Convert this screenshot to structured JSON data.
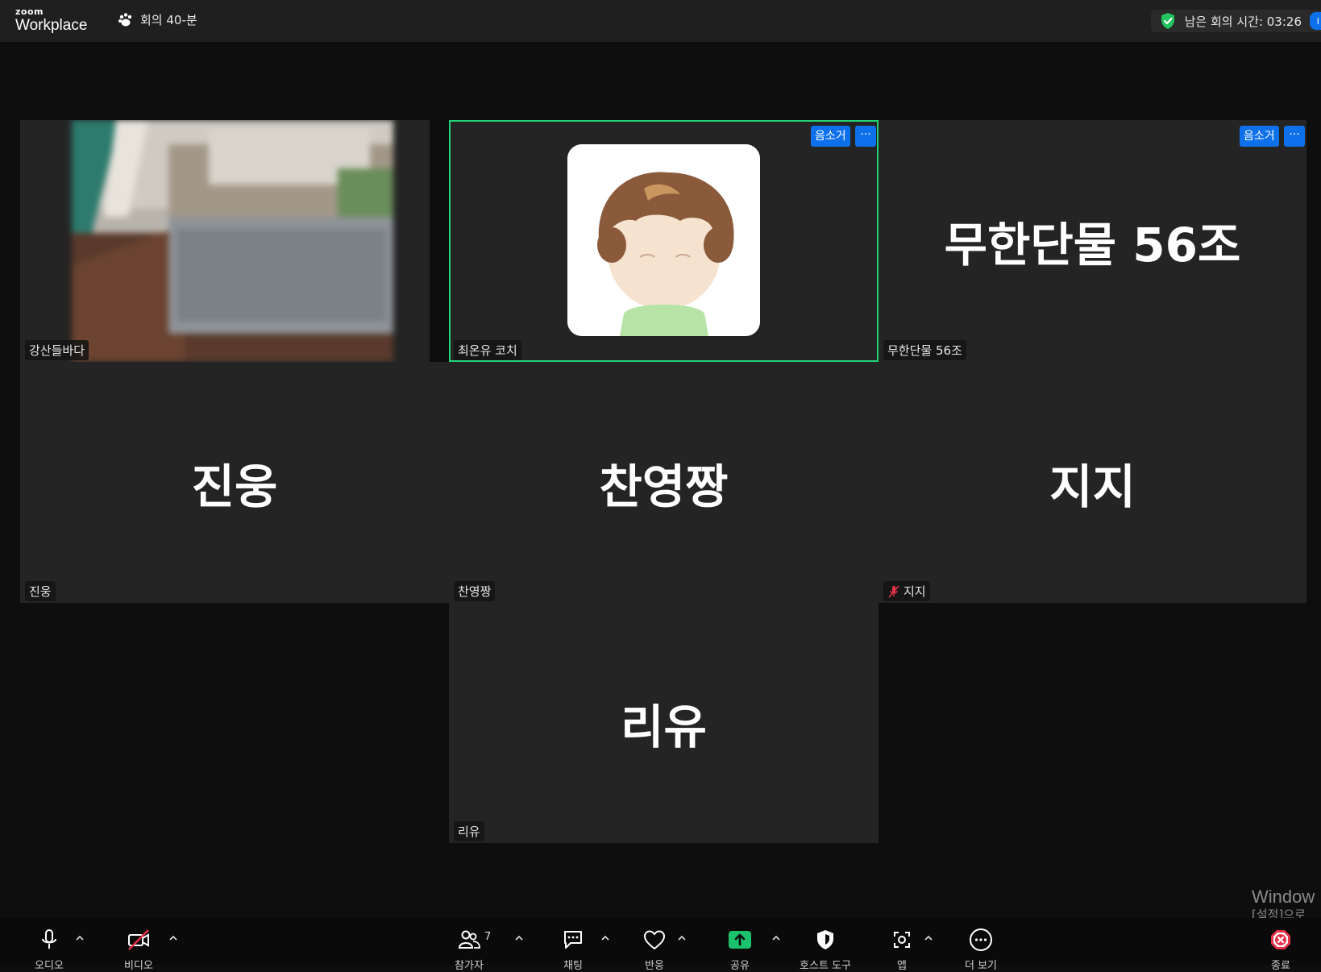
{
  "app": {
    "logo_small": "zoom",
    "logo_big": "Workplace",
    "meeting_title": "회의 40-분",
    "timer_text": "남은 회의 시간: 03:26"
  },
  "tiles": {
    "t1": {
      "name": "강산들바다"
    },
    "t2": {
      "name": "최온유 코치",
      "mute_label": "음소거",
      "more_label": "···"
    },
    "t3": {
      "display": "무한단물 56조",
      "name": "무한단물 56조",
      "mute_label": "음소거",
      "more_label": "···"
    },
    "t4": {
      "display": "진웅",
      "name": "진웅"
    },
    "t5": {
      "display": "찬영짱",
      "name": "찬영짱"
    },
    "t6": {
      "display": "지지",
      "name": "지지"
    },
    "t7": {
      "display": "리유",
      "name": "리유"
    }
  },
  "toolbar": {
    "audio": "오디오",
    "video": "비디오",
    "participants": "참가자",
    "participants_count": "7",
    "chat": "채팅",
    "reactions": "반응",
    "share": "공유",
    "host_tools": "호스트 도구",
    "apps": "앱",
    "more": "더 보기",
    "end": "종료"
  },
  "watermark": {
    "line1": "Window",
    "line2": "[설정]으로"
  },
  "colors": {
    "accent_blue": "#0e71eb",
    "active_speaker": "#22d376",
    "share_green": "#19c26b",
    "end_red": "#e5334a"
  }
}
